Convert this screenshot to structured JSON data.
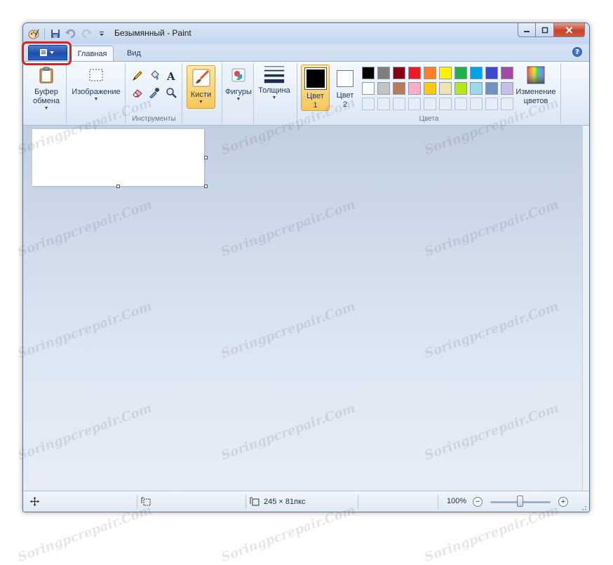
{
  "window": {
    "title": "Безымянный - Paint"
  },
  "tabs": [
    {
      "label": "Главная",
      "active": true
    },
    {
      "label": "Вид",
      "active": false
    }
  ],
  "ribbon": {
    "clipboard": {
      "label": "Буфер обмена"
    },
    "image": {
      "label": "Изображение"
    },
    "tools": {
      "group_label": "Инструменты"
    },
    "brushes": {
      "label": "Кисти"
    },
    "shapes": {
      "label": "Фигуры"
    },
    "size": {
      "label": "Толщина"
    },
    "color1": {
      "label_line1": "Цвет",
      "label_line2": "1",
      "value": "#000000"
    },
    "color2": {
      "label_line1": "Цвет",
      "label_line2": "2",
      "value": "#ffffff"
    },
    "edit_colors": {
      "label_line1": "Изменение",
      "label_line2": "цветов"
    },
    "colors_group_label": "Цвета",
    "palette_row1": [
      "#000000",
      "#7f7f7f",
      "#880015",
      "#ed1c24",
      "#ff7f27",
      "#fff200",
      "#22b14c",
      "#00a2e8",
      "#3f48cc",
      "#a349a4"
    ],
    "palette_row2": [
      "#ffffff",
      "#c3c3c3",
      "#b97a57",
      "#ffaec9",
      "#ffc90e",
      "#efe4b0",
      "#b5e61d",
      "#99d9ea",
      "#7092be",
      "#c8bfe7"
    ]
  },
  "statusbar": {
    "image_size": "245 × 81пкс",
    "zoom": "100%",
    "zoom_level": 1.0
  },
  "watermark": "Soringpcrepair.Com",
  "accent": {
    "highlight": "#e0201c",
    "app_button": "#1d4fa8"
  },
  "icons": [
    "paint-app-icon",
    "save-icon",
    "undo-icon",
    "redo-icon",
    "customize-qat-icon",
    "minimize-icon",
    "maximize-icon",
    "close-icon",
    "help-icon",
    "clipboard-icon",
    "select-icon",
    "pencil-icon",
    "fill-icon",
    "text-icon",
    "eraser-icon",
    "color-picker-icon",
    "magnifier-icon",
    "brushes-icon",
    "shapes-icon",
    "size-icon",
    "edit-colors-icon",
    "cursor-position-icon",
    "selection-size-icon",
    "image-size-icon",
    "zoom-out-icon",
    "zoom-in-icon"
  ]
}
